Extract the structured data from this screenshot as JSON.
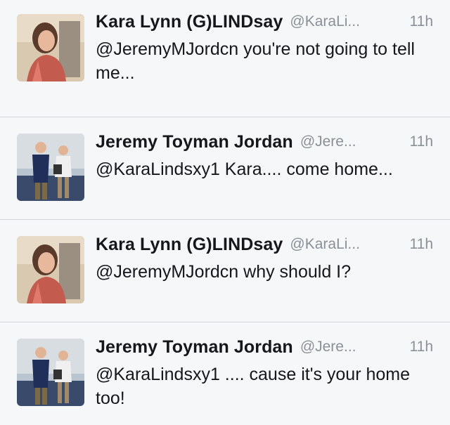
{
  "tweets": [
    {
      "name": "Kara Lynn (G)LINDsay",
      "handle": "@KaraLi...",
      "time": "11h",
      "text": "@JeremyMJordcn you're not going to tell me...",
      "avatar": "kara-avatar"
    },
    {
      "name": "Jeremy Toyman Jordan",
      "handle": "@Jere...",
      "time": "11h",
      "text": "@KaraLindsxy1  Kara.... come home...",
      "avatar": "jeremy-avatar"
    },
    {
      "name": "Kara Lynn (G)LINDsay",
      "handle": "@KaraLi...",
      "time": "11h",
      "text": "@JeremyMJordcn why should I?",
      "avatar": "kara-avatar"
    },
    {
      "name": "Jeremy Toyman Jordan",
      "handle": "@Jere...",
      "time": "11h",
      "text": "@KaraLindsxy1 .... cause it's your home too!",
      "avatar": "jeremy-avatar"
    }
  ]
}
